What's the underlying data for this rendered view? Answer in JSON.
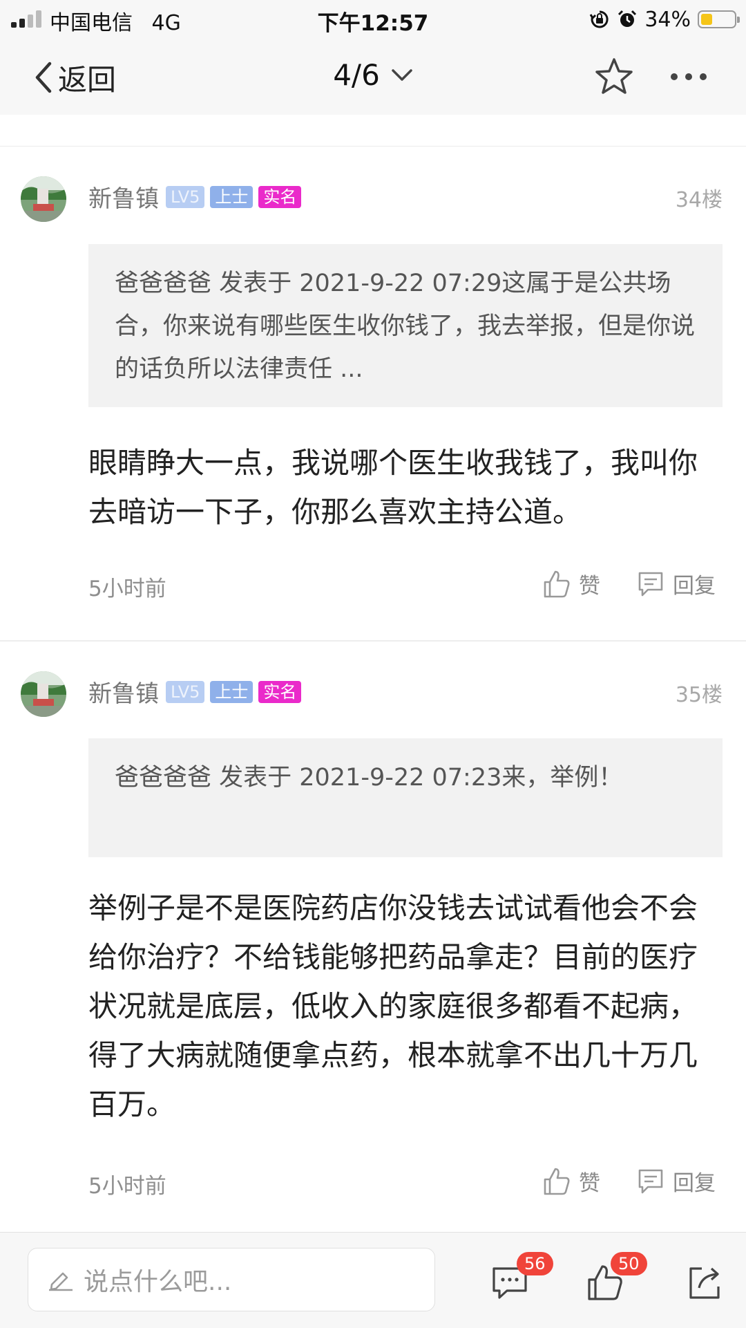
{
  "status_bar": {
    "carrier": "中国电信",
    "network": "4G",
    "time": "下午12:57",
    "battery_percent": "34%",
    "battery_level": 0.34
  },
  "nav": {
    "back_label": "返回",
    "page_indicator": "4/6"
  },
  "posts": [
    {
      "author": "新鲁镇",
      "badges": {
        "level": "LV5",
        "rank": "上士",
        "verified": "实名"
      },
      "floor": "34楼",
      "quote": "爸爸爸爸 发表于 2021-9-22 07:29这属于是公共场合，你来说有哪些医生收你钱了，我去举报，但是你说的话负所以法律责任 ...",
      "body": "眼睛睁大一点，我说哪个医生收我钱了，我叫你去暗访一下子，你那么喜欢主持公道。",
      "time": "5小时前",
      "like_label": "赞",
      "reply_label": "回复"
    },
    {
      "author": "新鲁镇",
      "badges": {
        "level": "LV5",
        "rank": "上士",
        "verified": "实名"
      },
      "floor": "35楼",
      "quote": "爸爸爸爸 发表于 2021-9-22 07:23来，举例！",
      "body": "举例子是不是医院药店你没钱去试试看他会不会给你治疗？不给钱能够把药品拿走？目前的医疗状况就是底层，低收入的家庭很多都看不起病，得了大病就随便拿点药，根本就拿不出几十万几百万。",
      "time": "5小时前",
      "like_label": "赞",
      "reply_label": "回复"
    }
  ],
  "bottom_bar": {
    "comment_placeholder": "说点什么吧...",
    "comment_count": "56",
    "like_count": "50"
  },
  "colors": {
    "badge_level": "#b7cdf3",
    "badge_rank": "#8fb0ea",
    "badge_verified": "#ea2aca",
    "count_badge": "#f0443a",
    "battery_fill": "#f5c518"
  },
  "icons": [
    "signal-icon",
    "orientation-lock-icon",
    "alarm-icon",
    "battery-icon",
    "chevron-left-icon",
    "chevron-down-icon",
    "star-icon",
    "more-icon",
    "thumbs-up-icon",
    "comment-icon",
    "pencil-icon",
    "share-icon"
  ]
}
